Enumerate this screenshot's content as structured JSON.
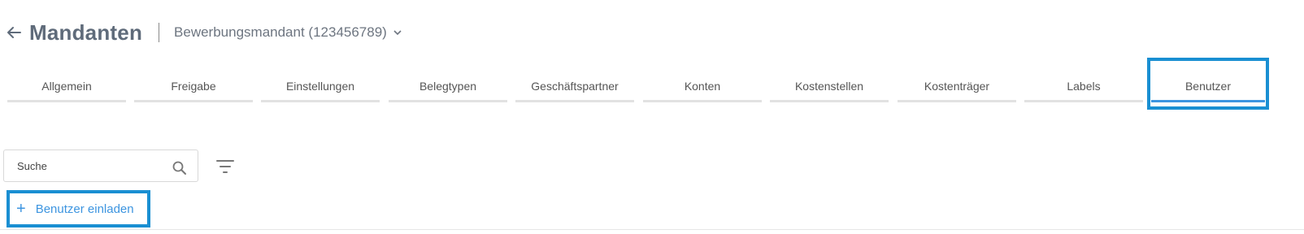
{
  "header": {
    "title": "Mandanten",
    "client_name": "Bewerbungsmandant (123456789)"
  },
  "tabs": [
    {
      "label": "Allgemein",
      "active": false
    },
    {
      "label": "Freigabe",
      "active": false
    },
    {
      "label": "Einstellungen",
      "active": false
    },
    {
      "label": "Belegtypen",
      "active": false
    },
    {
      "label": "Geschäftspartner",
      "active": false
    },
    {
      "label": "Konten",
      "active": false
    },
    {
      "label": "Kostenstellen",
      "active": false
    },
    {
      "label": "Kostenträger",
      "active": false
    },
    {
      "label": "Labels",
      "active": false
    },
    {
      "label": "Benutzer",
      "active": true
    }
  ],
  "search": {
    "placeholder": "Suche",
    "value": ""
  },
  "actions": {
    "invite_label": "Benutzer einladen"
  },
  "colors": {
    "accent": "#3d95e0",
    "highlight": "#1a8fd2",
    "title": "#5f6b7a"
  }
}
